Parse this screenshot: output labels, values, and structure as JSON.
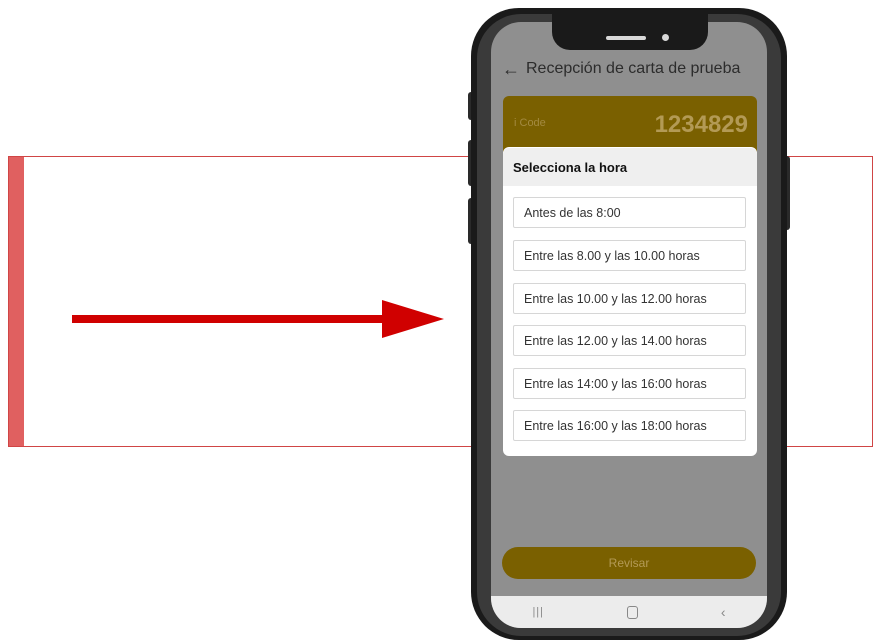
{
  "screen": {
    "title": "Recepción de carta de prueba",
    "icode": {
      "label": "i Code",
      "value": "1234829"
    }
  },
  "dialog": {
    "title": "Selecciona la hora",
    "options": [
      "Antes de las 8:00",
      "Entre las 8.00 y las 10.00 horas",
      "Entre las 10.00 y las 12.00 horas",
      "Entre las 12.00 y las 14.00 horas",
      "Entre las 14:00 y las 16:00 horas",
      "Entre las 16:00 y las 18:00 horas"
    ]
  },
  "review_button": "Revisar",
  "navbar": {
    "recents": "|||",
    "back": "‹"
  },
  "colors": {
    "highlight": "#d04545",
    "arrow": "#d00000",
    "accent": "#7a6000"
  }
}
